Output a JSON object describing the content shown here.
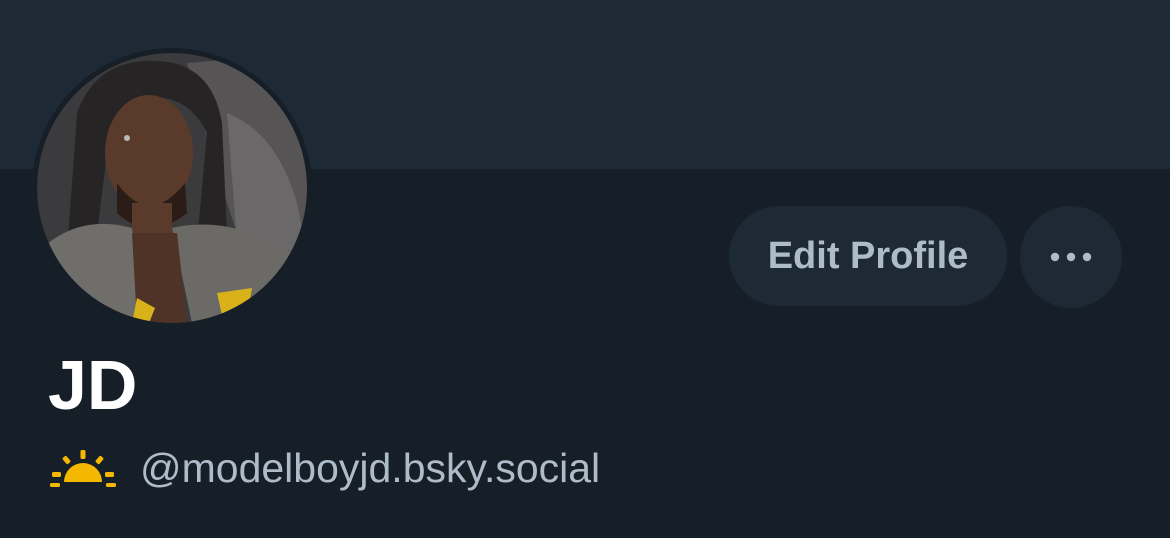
{
  "profile": {
    "display_name": "JD",
    "handle": "@modelboyjd.bsky.social",
    "handle_prefix_icon": "sunrise-emoji-icon",
    "avatar_icon": "profile-avatar"
  },
  "actions": {
    "edit_profile_label": "Edit Profile",
    "more_icon": "ellipsis-icon"
  },
  "colors": {
    "background": "#161e27",
    "banner": "#1e2936",
    "button_bg": "#1e2936",
    "button_text": "#aebbc9",
    "name_text": "#ffffff",
    "handle_text": "#aebbc9",
    "sun_emoji": "#f5b800"
  }
}
